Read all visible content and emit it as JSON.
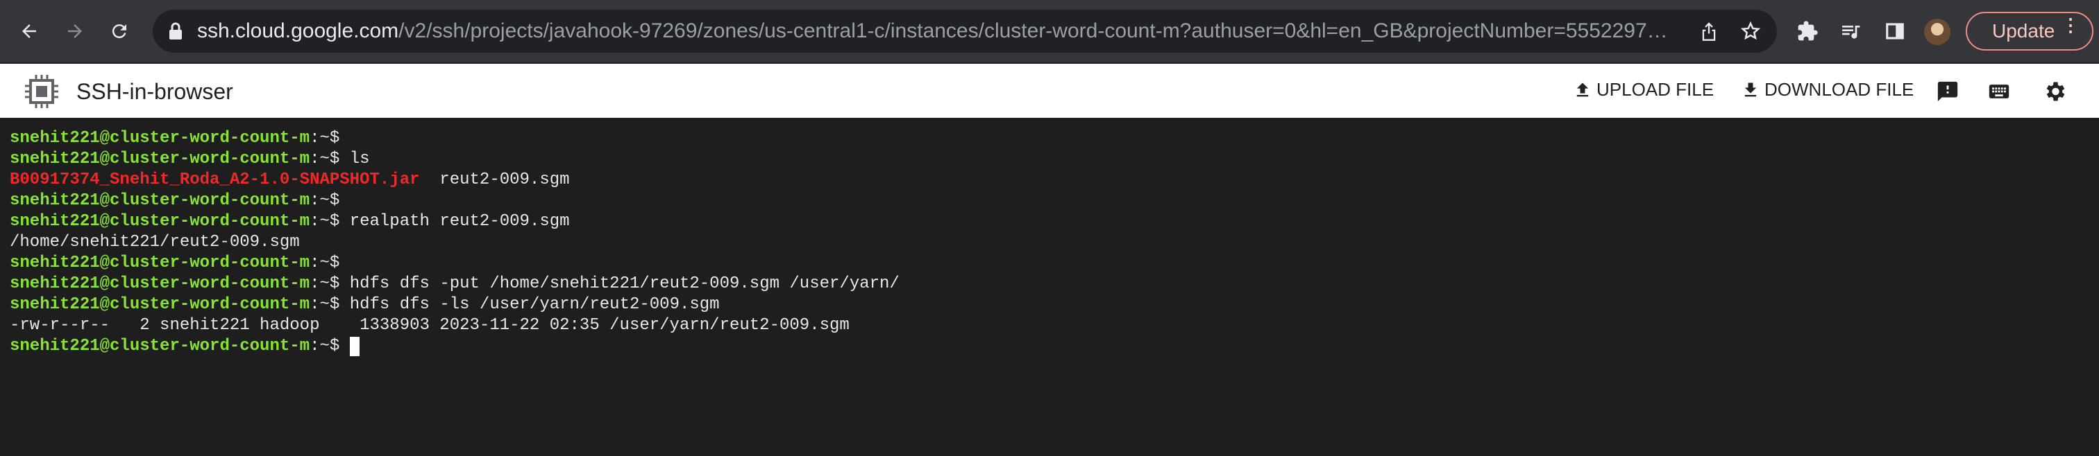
{
  "browser": {
    "url_host": "ssh.cloud.google.com",
    "url_path": "/v2/ssh/projects/javahook-97269/zones/us-central1-c/instances/cluster-word-count-m?authuser=0&hl=en_GB&projectNumber=5552297…",
    "update_label": "Update",
    "icons": [
      "back-icon",
      "forward-icon",
      "reload-icon",
      "lock-icon",
      "share-icon",
      "star-icon",
      "extensions-icon",
      "media-icon",
      "side-panel-icon",
      "avatar",
      "more-icon"
    ]
  },
  "ssh": {
    "title": "SSH-in-browser",
    "upload_label": "UPLOAD FILE",
    "download_label": "DOWNLOAD FILE",
    "icons": [
      "feedback-icon",
      "keyboard-icon",
      "settings-icon"
    ]
  },
  "terminal": {
    "prompt": "snehit221@cluster-word-count-m",
    "prompt_suffix": ":~$",
    "lines": [
      {
        "cmd": ""
      },
      {
        "cmd": " ls"
      },
      {
        "jar": "B00917374_Snehit_Roda_A2-1.0-SNAPSHOT.jar",
        "text": "  reut2-009.sgm"
      },
      {
        "cmd": ""
      },
      {
        "cmd": " realpath reut2-009.sgm"
      },
      {
        "text": "/home/snehit221/reut2-009.sgm"
      },
      {
        "cmd": ""
      },
      {
        "cmd": " hdfs dfs -put /home/snehit221/reut2-009.sgm /user/yarn/"
      },
      {
        "cmd": " hdfs dfs -ls /user/yarn/reut2-009.sgm"
      },
      {
        "text": "-rw-r--r--   2 snehit221 hadoop    1338903 2023-11-22 02:35 /user/yarn/reut2-009.sgm"
      },
      {
        "cmd": " "
      }
    ]
  },
  "colors": {
    "prompt": "#8ae234",
    "jar": "#ef2929",
    "terminal_bg": "#1e1e1e",
    "chrome_bg": "#35363a",
    "update_border": "#f28b82"
  }
}
